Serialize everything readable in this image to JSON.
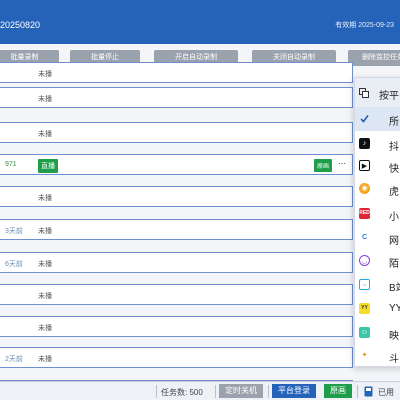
{
  "header": {
    "version": "20250820",
    "expire_label": "有效期",
    "expire_date": "2025-09-23"
  },
  "toolbar": {
    "buttons": [
      "批量录制",
      "批量停止",
      "开启自动录制",
      "关闭自动录制",
      "删除监控任务"
    ]
  },
  "table": {
    "rows": [
      {
        "num": "",
        "status": "未播"
      },
      {
        "num": "",
        "status": "未播"
      },
      {
        "num": "",
        "status": "未播"
      },
      {
        "num": "971",
        "status": "直播",
        "live": true,
        "original": "原画"
      },
      {
        "num": "",
        "status": "未播"
      },
      {
        "num": "3天前",
        "status": "未播"
      },
      {
        "num": "6天前",
        "status": "未播"
      },
      {
        "num": "",
        "status": "未播"
      },
      {
        "num": "",
        "status": "未播"
      },
      {
        "num": "2天前",
        "status": "未播"
      },
      {
        "num": "",
        "status": "未播"
      }
    ]
  },
  "dropdown": {
    "header": "按平",
    "items": [
      {
        "label": "所",
        "icon": "check-icon",
        "checked": true
      },
      {
        "label": "抖",
        "icon": "douyin-icon"
      },
      {
        "label": "快",
        "icon": "kuaishou-icon"
      },
      {
        "label": "虎",
        "icon": "huya-icon"
      },
      {
        "label": "小",
        "icon": "xiaohongshu-icon"
      },
      {
        "label": "网",
        "icon": "netease-icon"
      },
      {
        "label": "陌",
        "icon": "momo-icon"
      },
      {
        "label": "B站",
        "icon": "bilibili-icon"
      },
      {
        "label": "YY",
        "icon": "yy-icon"
      },
      {
        "label": "映",
        "icon": "yingke-icon"
      },
      {
        "label": "斗",
        "icon": "douyu-icon"
      }
    ]
  },
  "statusbar": {
    "task_count_label": "任务数: 500",
    "timer_shutdown": "定时关机",
    "platform_login": "平台登录",
    "original": "原画",
    "used": "已用"
  },
  "colors": {
    "header_bg": "#2563b8",
    "row_border": "#6f8fd0",
    "live_green": "#1e9e4a",
    "toolbar_btn": "#9aa2ad"
  }
}
